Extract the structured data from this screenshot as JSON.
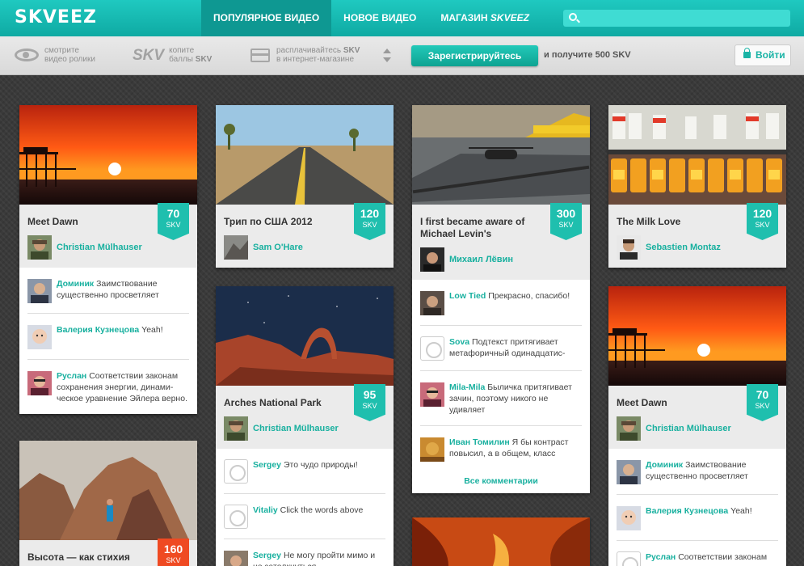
{
  "app": {
    "logo": "SKVEEZ"
  },
  "nav": {
    "popular": "ПОПУЛЯРНОЕ ВИДЕО",
    "new": "НОВОЕ ВИДЕО",
    "shop": "МАГАЗИН",
    "shop_brand": "SKVEEZ"
  },
  "search": {
    "placeholder": ""
  },
  "steps": {
    "watch_l1": "смотрите",
    "watch_l2": "видео ролики",
    "skv_logo": "SKV",
    "collect_l1": "копите",
    "collect_l2": "баллы",
    "collect_skv": "SKV",
    "pay_l1": "расплачивайтесь",
    "pay_skv": "SKV",
    "pay_l2": "в интернет-магазине"
  },
  "register": {
    "button": "Зарегистрируйтесь",
    "bonus": "и получите 500 SKV"
  },
  "login": {
    "label": "Войти"
  },
  "cards": [
    {
      "title": "Meet Dawn",
      "skv": "70",
      "unit": "SKV",
      "author": "Christian Mülhauser",
      "comments": [
        {
          "name": "Доминик",
          "text": "Заимствование существенно просветляет"
        },
        {
          "name": "Валерия Кузнецова",
          "text": "Yeah!"
        },
        {
          "name": "Руслан",
          "text": "Соответствии законам сохранения энергии, динами-ческое уравнение Эйлера верно."
        }
      ]
    },
    {
      "title": "Высота — как стихия",
      "skv": "160",
      "unit": "SKV"
    },
    {
      "title": "Трип по США 2012",
      "skv": "120",
      "unit": "SKV",
      "author": "Sam O'Hare"
    },
    {
      "title": "Arches National Park",
      "skv": "95",
      "unit": "SKV",
      "author": "Christian Mülhauser",
      "comments": [
        {
          "name": "Sergey",
          "text": "Это чудо природы!"
        },
        {
          "name": "Vitaliy",
          "text": "Click the words above"
        },
        {
          "name": "Sergey",
          "text": "Не могу пройти мимо и не затолкнуться"
        }
      ]
    },
    {
      "title": "I first became aware of Michael Levin's",
      "skv": "300",
      "unit": "SKV",
      "author": "Михаил Лёвин",
      "comments": [
        {
          "name": "Low Tied",
          "text": "Прекрасно, спасибо!"
        },
        {
          "name": "Sova",
          "text": "Подтекст притягивает метафоричный одинадцатис-"
        },
        {
          "name": "Mila-Mila",
          "text": "Быличка притягивает зачин, поэтому никого не удивляет"
        },
        {
          "name": "Иван Томилин",
          "text": "Я бы контраст повысил, а в общем, класс"
        }
      ],
      "all_comments": "Все комментарии"
    },
    {
      "title": "The Milk Love",
      "skv": "120",
      "unit": "SKV",
      "author": "Sebastien Montaz"
    },
    {
      "title": "Meet Dawn",
      "skv": "70",
      "unit": "SKV",
      "author": "Christian Mülhauser",
      "comments": [
        {
          "name": "Доминик",
          "text": "Заимствование существенно просветляет"
        },
        {
          "name": "Валерия Кузнецова",
          "text": "Yeah!"
        },
        {
          "name": "Руслан",
          "text": "Соответствии законам"
        }
      ]
    }
  ]
}
